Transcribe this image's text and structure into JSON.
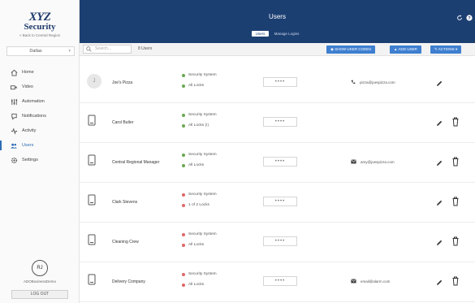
{
  "sidebar": {
    "logo_line1": "XYZ",
    "logo_line2": "Security",
    "back_link": "< Back to Central Region",
    "location": "Dallas",
    "nav": [
      {
        "label": "Home",
        "icon": "home-icon"
      },
      {
        "label": "Video",
        "icon": "video-icon"
      },
      {
        "label": "Automation",
        "icon": "automation-icon"
      },
      {
        "label": "Notifications",
        "icon": "notification-icon"
      },
      {
        "label": "Activity",
        "icon": "activity-icon"
      },
      {
        "label": "Users",
        "icon": "users-icon"
      },
      {
        "label": "Settings",
        "icon": "gear-icon"
      }
    ],
    "active_nav": "Users",
    "avatar_initials": "RJ",
    "account_name": "ADOBusinessDemo",
    "logout_label": "LOG OUT"
  },
  "header": {
    "title": "Users",
    "tabs": [
      {
        "label": "Users",
        "active": true
      },
      {
        "label": "Manage Logins",
        "active": false
      }
    ]
  },
  "toolbar": {
    "search_placeholder": "Search...",
    "user_count": "8 Users",
    "show_codes_label": "SHOW USER CODES",
    "add_user_label": "ADD USER",
    "actions_label": "ACTIONS"
  },
  "colors": {
    "header_bg": "#1c3f72",
    "button_bg": "#3e7fd0",
    "status_green": "#6aa84f",
    "status_red": "#e06666",
    "active_nav": "#2e6db5"
  },
  "users": [
    {
      "name": "Joe's Pizza",
      "type": "person",
      "initial": "J",
      "perm1": "Security System",
      "perm2": "All Locks",
      "perm_status": "green",
      "pin": "••••",
      "contact_type": "phone",
      "contact": "pizza@joespizza.com",
      "deletable": false
    },
    {
      "name": "Carol Butler",
      "type": "device",
      "perm1": "Security System",
      "perm2": "All Locks (!)",
      "perm_status": "green",
      "pin": "••••",
      "contact_type": "none",
      "contact": "",
      "deletable": true
    },
    {
      "name": "Central Regional Manager",
      "type": "device",
      "perm1": "Security System",
      "perm2": "All Locks",
      "perm_status": "green",
      "pin": "••••",
      "contact_type": "email",
      "contact": "amy@joespizza.com",
      "deletable": true
    },
    {
      "name": "Clark Stevens",
      "type": "device",
      "perm1": "Security System",
      "perm2": "1 of 2 Locks",
      "perm_status": "red",
      "pin": "••••",
      "contact_type": "none",
      "contact": "",
      "deletable": true
    },
    {
      "name": "Cleaning Crew",
      "type": "device",
      "perm1": "Security System",
      "perm2": "All Locks",
      "perm_status": "red",
      "pin": "••••",
      "contact_type": "none",
      "contact": "",
      "deletable": true
    },
    {
      "name": "Delivery Company",
      "type": "device",
      "perm1": "Security System",
      "perm2": "All Locks",
      "perm_status": "red",
      "pin": "••••",
      "contact_type": "email",
      "contact": "email@alarm.com",
      "deletable": true
    }
  ]
}
